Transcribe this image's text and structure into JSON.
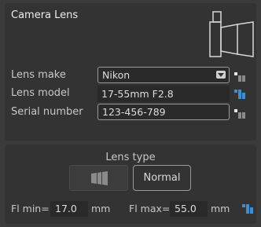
{
  "title": "Camera Lens",
  "lens_make": {
    "label": "Lens make",
    "value": "Nikon"
  },
  "lens_model": {
    "label": "Lens model",
    "value": "17-55mm F2.8"
  },
  "serial_number": {
    "label": "Serial number",
    "value": "123-456-789"
  },
  "lens_type": {
    "label": "Lens type",
    "normal_label": "Normal"
  },
  "fl_min": {
    "label": "Fl min=",
    "value": "17.0",
    "unit": "mm"
  },
  "fl_max": {
    "label": "Fl max=",
    "value": "55.0",
    "unit": "mm"
  },
  "colors": {
    "accent": "#3a8fd6",
    "background": "#3b3b3b",
    "field": "#2a2a2a"
  },
  "icons": [
    "camera-icon",
    "dropdown-arrow-icon",
    "preset-grid-icon",
    "lens-icon"
  ]
}
